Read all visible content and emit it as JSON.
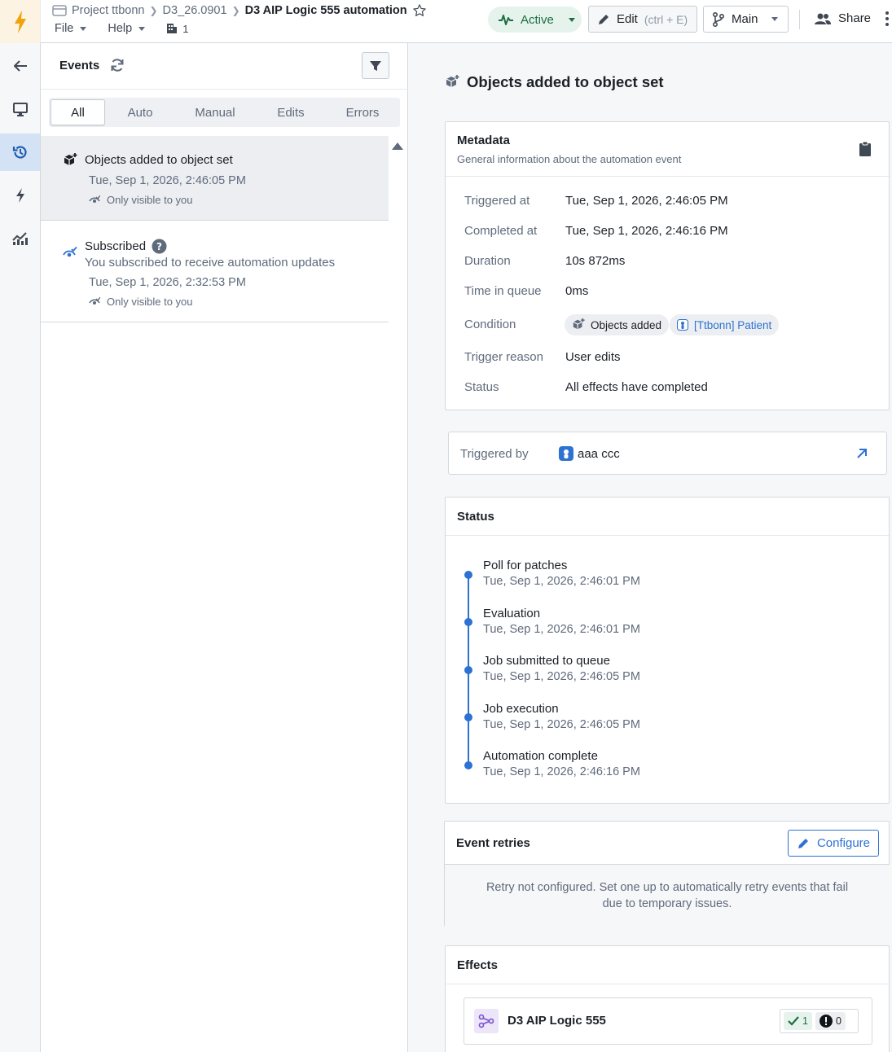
{
  "header": {
    "breadcrumbs": [
      "Project ttbonn",
      "D3_26.0901"
    ],
    "title": "D3 AIP Logic 555 automation",
    "menus": [
      "File",
      "Help"
    ],
    "workspace_count": "1",
    "status_label": "Active",
    "edit_label": "Edit",
    "edit_shortcut": "(ctrl + E)",
    "branch_label": "Main",
    "share_label": "Share"
  },
  "rail": {
    "items": [
      "back-icon",
      "monitor-icon",
      "history-icon",
      "bolt-icon",
      "analytics-icon"
    ],
    "selected": "history-icon"
  },
  "events": {
    "title": "Events",
    "tabs": [
      "All",
      "Auto",
      "Manual",
      "Edits",
      "Errors"
    ],
    "selected_tab": "All",
    "items": [
      {
        "title": "Objects added to object set",
        "date": "Tue, Sep 1, 2026, 2:46:05 PM",
        "visibility": "Only visible to you"
      },
      {
        "title": "Subscribed",
        "subtitle": "You subscribed to receive automation updates",
        "date": "Tue, Sep 1, 2026, 2:32:53 PM",
        "visibility": "Only visible to you"
      }
    ]
  },
  "detail": {
    "title": "Objects added to object set",
    "metadata": {
      "heading": "Metadata",
      "subheading": "General information about the automation event",
      "rows": [
        {
          "key": "Triggered at",
          "value": "Tue, Sep 1, 2026, 2:46:05 PM"
        },
        {
          "key": "Completed at",
          "value": "Tue, Sep 1, 2026, 2:46:16 PM"
        },
        {
          "key": "Duration",
          "value": "10s 872ms"
        },
        {
          "key": "Time in queue",
          "value": "0ms"
        },
        {
          "key": "Condition",
          "value": ""
        },
        {
          "key": "Trigger reason",
          "value": "User edits"
        },
        {
          "key": "Status",
          "value": "All effects have completed"
        }
      ],
      "condition_chips": [
        "Objects added",
        "[Ttbonn] Patient"
      ]
    },
    "triggered_by": {
      "label": "Triggered by",
      "user": "aaa ccc"
    },
    "status": {
      "heading": "Status",
      "steps": [
        {
          "name": "Poll for patches",
          "date": "Tue, Sep 1, 2026, 2:46:01 PM"
        },
        {
          "name": "Evaluation",
          "date": "Tue, Sep 1, 2026, 2:46:01 PM"
        },
        {
          "name": "Job submitted to queue",
          "date": "Tue, Sep 1, 2026, 2:46:05 PM"
        },
        {
          "name": "Job execution",
          "date": "Tue, Sep 1, 2026, 2:46:05 PM"
        },
        {
          "name": "Automation complete",
          "date": "Tue, Sep 1, 2026, 2:46:16 PM"
        }
      ]
    },
    "retries": {
      "heading": "Event retries",
      "configure_label": "Configure",
      "message": "Retry not configured. Set one up to automatically retry events that fail due to temporary issues."
    },
    "effects": {
      "heading": "Effects",
      "items": [
        {
          "name": "D3 AIP Logic 555",
          "success_count": "1",
          "error_count": "0"
        }
      ]
    }
  },
  "colors": {
    "accent": "#2d72d2",
    "active_green": "#1c6e42",
    "logo_orange": "#f0a30a"
  }
}
